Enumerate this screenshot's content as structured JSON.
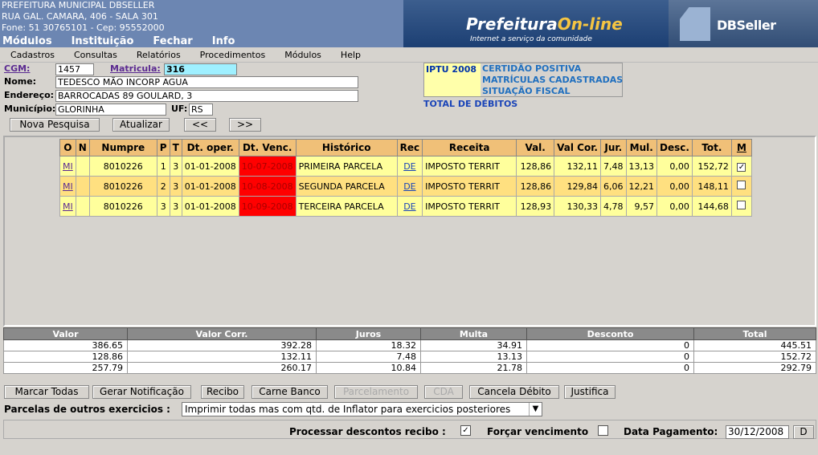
{
  "header": {
    "line1": "PREFEITURA MUNICIPAL DBSELLER",
    "line2": "RUA GAL. CAMARA, 406 - SALA 301",
    "line3": "Fone: 51 30765101  -  Cep: 95552000",
    "menu": [
      "Módulos",
      "Instituição",
      "Fechar",
      "Info"
    ],
    "banner_title_a": "Prefeitura",
    "banner_title_b": "On-line",
    "banner_sub": "Internet a serviço da comunidade",
    "brand": "DBSeller"
  },
  "menubar": [
    "Cadastros",
    "Consultas",
    "Relatórios",
    "Procedimentos",
    "Módulos",
    "Help"
  ],
  "form": {
    "cgm_label": "CGM:",
    "cgm": "1457",
    "matricula_label": "Matricula:",
    "matricula": "316",
    "nome_label": "Nome:",
    "nome": "TEDESCO MÃO INCORP AGUA",
    "endereco_label": "Endereço:",
    "endereco": "BARROCADAS 89 GOULARD, 3",
    "municipio_label": "Município:",
    "municipio": "GLORINHA",
    "uf_label": "UF:",
    "uf": "RS"
  },
  "buttons": {
    "nova": "Nova Pesquisa",
    "atualizar": "Atualizar",
    "prev": "<<",
    "next": ">>"
  },
  "info": {
    "iptu": "IPTU 2008",
    "links": [
      "CERTIDÃO POSITIVA",
      "MATRÍCULAS CADASTRADAS",
      "SITUAÇÃO FISCAL"
    ],
    "total": "TOTAL DE DÉBITOS"
  },
  "table": {
    "headers": [
      "O",
      "N",
      "Numpre",
      "P",
      "T",
      "Dt. oper.",
      "Dt. Venc.",
      "Histórico",
      "Rec",
      "Receita",
      "Val.",
      "Val Cor.",
      "Jur.",
      "Mul.",
      "Desc.",
      "Tot.",
      "M"
    ],
    "rows": [
      {
        "o": "MI",
        "n": "",
        "numpre": "8010226",
        "p": "1",
        "t": "3",
        "oper": "01-01-2008",
        "venc": "10-07-2008",
        "hist": "PRIMEIRA PARCELA",
        "rec": "DE",
        "receita": "IMPOSTO TERRIT",
        "val": "128,86",
        "valcor": "132,11",
        "jur": "7,48",
        "mul": "13,13",
        "desc": "0,00",
        "tot": "152,72",
        "m": "✓"
      },
      {
        "o": "MI",
        "n": "",
        "numpre": "8010226",
        "p": "2",
        "t": "3",
        "oper": "01-01-2008",
        "venc": "10-08-2008",
        "hist": "SEGUNDA PARCELA",
        "rec": "DE",
        "receita": "IMPOSTO TERRIT",
        "val": "128,86",
        "valcor": "129,84",
        "jur": "6,06",
        "mul": "12,21",
        "desc": "0,00",
        "tot": "148,11",
        "m": ""
      },
      {
        "o": "MI",
        "n": "",
        "numpre": "8010226",
        "p": "3",
        "t": "3",
        "oper": "01-01-2008",
        "venc": "10-09-2008",
        "hist": "TERCEIRA PARCELA",
        "rec": "DE",
        "receita": "IMPOSTO TERRIT",
        "val": "128,93",
        "valcor": "130,33",
        "jur": "4,78",
        "mul": "9,57",
        "desc": "0,00",
        "tot": "144,68",
        "m": ""
      }
    ]
  },
  "summary": {
    "headers": [
      "Valor",
      "Valor Corr.",
      "Juros",
      "Multa",
      "Desconto",
      "Total"
    ],
    "rows": [
      [
        "386.65",
        "392.28",
        "18.32",
        "34.91",
        "0",
        "445.51"
      ],
      [
        "128.86",
        "132.11",
        "7.48",
        "13.13",
        "0",
        "152.72"
      ],
      [
        "257.79",
        "260.17",
        "10.84",
        "21.78",
        "0",
        "292.79"
      ]
    ]
  },
  "actions": [
    "Marcar Todas",
    "Gerar Notificação",
    "Recibo",
    "Carne Banco",
    "Parcelamento",
    "CDA",
    "Cancela Débito",
    "Justifica"
  ],
  "parcelas": {
    "label": "Parcelas de outros exercicios :",
    "selected": "Imprimir todas mas com qtd. de Inflator para exercicios posteriores"
  },
  "footer": {
    "proc_label": "Processar descontos recibo :",
    "proc_checked": "✓",
    "forcar_label": "Forçar vencimento",
    "data_label": "Data Pagamento:",
    "data": "30/12/2008",
    "d_btn": "D"
  }
}
